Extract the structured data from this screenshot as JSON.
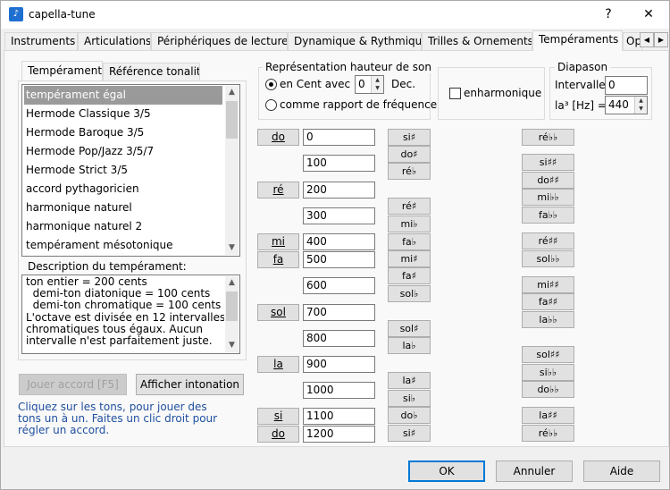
{
  "window": {
    "title": "capella-tune",
    "help": "?",
    "close": "✕"
  },
  "tabs": [
    "Instruments",
    "Articulations",
    "Périphériques de lecture",
    "Dynamique & Rythmique",
    "Trilles & Ornements",
    "Tempéraments",
    "Op"
  ],
  "subtabs": [
    "Tempérament",
    "Référence tonalité"
  ],
  "temperaments": [
    "tempérament égal",
    "Hermode Classique 3/5",
    "Hermode Baroque 3/5",
    "Hermode Pop/Jazz 3/5/7",
    "Hermode Strict 3/5",
    "accord pythagoricien",
    "harmonique naturel",
    "harmonique naturel 2",
    "tempérament mésotonique"
  ],
  "description": {
    "label": "Description du tempérament:",
    "text": "ton entier = 200 cents\n  demi-ton diatonique = 100 cents\n  demi-ton chromatique = 100 cents\nL'octave est divisée en 12 intervalles\nchromatiques tous égaux. Aucun\nintervalle n'est parfaitement juste."
  },
  "buttons": {
    "play": "Jouer accord [F5]",
    "show": "Afficher intonation",
    "ok": "OK",
    "cancel": "Annuler",
    "help": "Aide"
  },
  "hint": "Cliquez sur les tons, pour jouer des\ntons un à un. Faites un clic droit pour\nrégler un accord.",
  "representation": {
    "label": "Représentation hauteur de son",
    "cents_label": "en Cent avec",
    "cents_value": "0",
    "dec_label": "Dec.",
    "ratio_label": "comme rapport de fréquence"
  },
  "enharmonic_label": "enharmonique",
  "diapason": {
    "label": "Diapason",
    "interval_label": "Intervalle",
    "interval_value": "0",
    "la_label": "la³ [Hz] =",
    "la_value": "440"
  },
  "notes": [
    "do",
    "ré",
    "mi",
    "fa",
    "sol",
    "la",
    "si",
    "do"
  ],
  "cents": [
    "0",
    "100",
    "200",
    "300",
    "400",
    "500",
    "600",
    "700",
    "800",
    "900",
    "1000",
    "1100",
    "1200"
  ],
  "acc1": [
    "si♯",
    "do♯",
    "ré♭",
    "ré♯",
    "mi♭",
    "fa♭",
    "mi♯",
    "fa♯",
    "sol♭",
    "sol♯",
    "la♭",
    "la♯",
    "si♭",
    "do♭",
    "si♯"
  ],
  "acc2": [
    "ré♭♭",
    "si♯♯",
    "do♯♯",
    "mi♭♭",
    "fa♭♭",
    "ré♯♯",
    "sol♭♭",
    "mi♯♯",
    "fa♯♯",
    "la♭♭",
    "sol♯♯",
    "si♭♭",
    "do♭♭",
    "la♯♯",
    "ré♭♭"
  ]
}
